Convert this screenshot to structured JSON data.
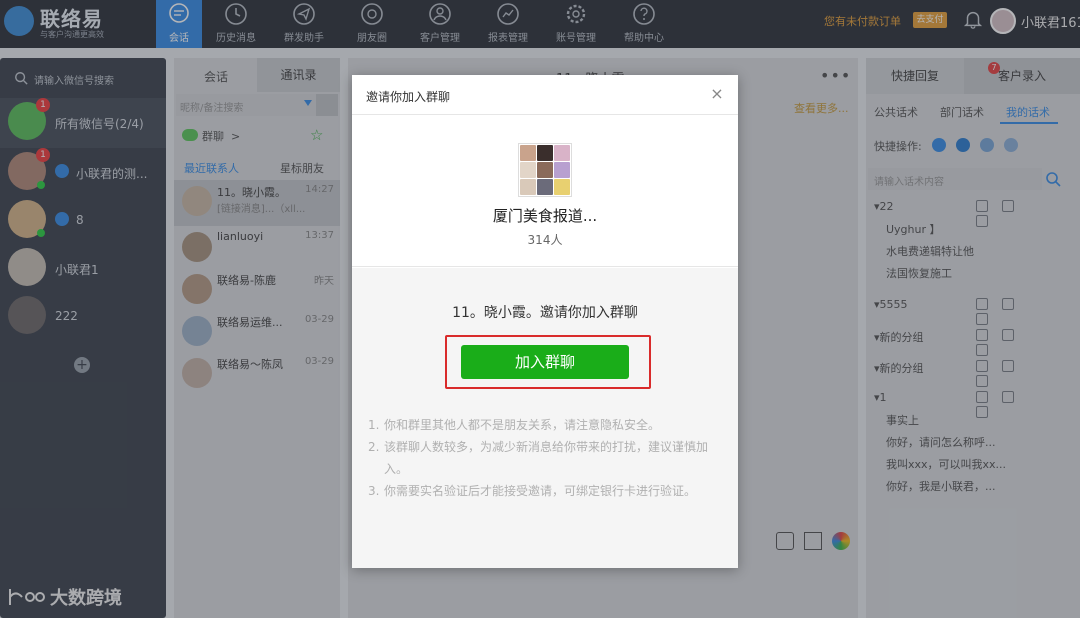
{
  "app": {
    "brand": "联络易",
    "slogan": "与客户沟通更高效",
    "nav": [
      {
        "label": "会话",
        "icon": "chat-bubble-icon",
        "active": true
      },
      {
        "label": "历史消息",
        "icon": "clock-icon"
      },
      {
        "label": "群发助手",
        "icon": "send-icon"
      },
      {
        "label": "朋友圈",
        "icon": "aperture-icon"
      },
      {
        "label": "客户管理",
        "icon": "person-icon"
      },
      {
        "label": "报表管理",
        "icon": "report-icon"
      },
      {
        "label": "账号管理",
        "icon": "gear-icon"
      },
      {
        "label": "帮助中心",
        "icon": "question-icon"
      }
    ],
    "unpaid_text": "您有未付款订单",
    "pay_label": "去支付",
    "user_name": "小联君161"
  },
  "accounts": {
    "search_placeholder": "请输入微信号搜索",
    "items": [
      {
        "name": "所有微信号(2/4)",
        "badge": "1"
      },
      {
        "name": "小联君的测...",
        "badge": "1"
      },
      {
        "name": "8",
        "badge": ""
      },
      {
        "name": "小联君1",
        "badge": ""
      },
      {
        "name": "222",
        "badge": ""
      }
    ]
  },
  "chatlist": {
    "tabs": [
      "会话",
      "通讯录"
    ],
    "search_placeholder": "昵称/备注搜索",
    "group_label": "群聊",
    "group_arrow": ">",
    "recent_label": "最近联系人",
    "fav_label": "星标朋友",
    "items": [
      {
        "name": "11。晓小霞。",
        "time": "14:27",
        "preview": "[链接消息]...（xll..."
      },
      {
        "name": "lianluoyi",
        "time": "13:37",
        "preview": ""
      },
      {
        "name": "联络易-陈鹿",
        "time": "昨天",
        "preview": ""
      },
      {
        "name": "联络易运维...",
        "time": "03-29",
        "preview": ""
      },
      {
        "name": "联络易～陈凤",
        "time": "03-29",
        "preview": ""
      }
    ]
  },
  "chat": {
    "title": "11。晓小霞。",
    "view_more": "查看更多..."
  },
  "right_panel": {
    "tabs": [
      "快捷回复",
      "客户录入"
    ],
    "tab_badge": "7",
    "subtabs": [
      "公共话术",
      "部门话术",
      "我的话术"
    ],
    "quick_label": "快捷操作:",
    "search_placeholder": "请输入话术内容",
    "groups": [
      {
        "title": "▾22",
        "items": [
          "Uyghur 】",
          "水电费递辑特让他",
          "法国恢复施工"
        ]
      },
      {
        "title": "▾5555",
        "items": []
      },
      {
        "title": "▾新的分组",
        "items": []
      },
      {
        "title": "▾新的分组",
        "items": []
      },
      {
        "title": "▾1",
        "items": [
          "事实上",
          "你好，请问怎么称呼...",
          "我叫xxx，可以叫我xx...",
          "你好，我是小联君，..."
        ]
      }
    ]
  },
  "modal": {
    "title": "邀请你加入群聊",
    "group_name": "厦门美食报道...",
    "member_count": "314人",
    "invite_text": "11。晓小霞。邀请你加入群聊",
    "join_label": "加入群聊",
    "notes": [
      {
        "num": "1.",
        "text": "你和群里其他人都不是朋友关系，请注意隐私安全。"
      },
      {
        "num": "2.",
        "text": "该群聊人数较多，为减少新消息给你带来的打扰，建议谨慎加入。"
      },
      {
        "num": "3.",
        "text": "你需要实名验证后才能接受邀请，可绑定银行卡进行验证。"
      }
    ]
  },
  "watermark": "大数跨境",
  "colors": {
    "accent": "#3a8ee6",
    "join_green": "#1aad19",
    "highlight_red": "#d92b2b"
  }
}
